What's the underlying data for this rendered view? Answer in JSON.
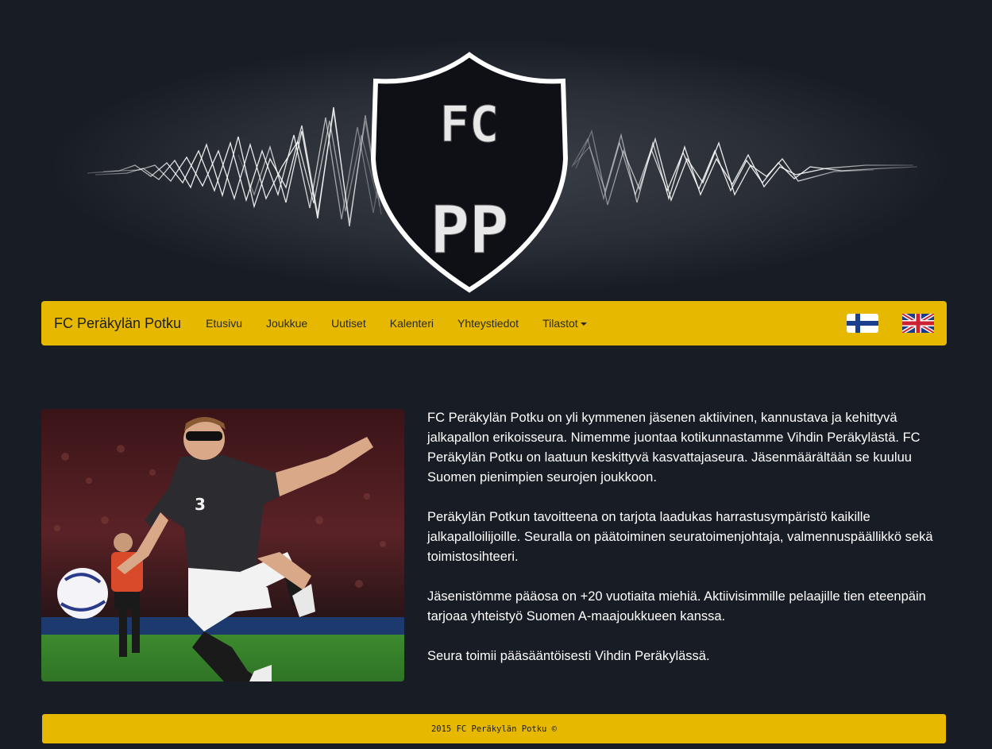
{
  "logo": {
    "top_letters": "FC",
    "bottom_letters": "PP"
  },
  "navbar": {
    "brand": "FC Peräkylän Potku",
    "items": [
      {
        "label": "Etusivu"
      },
      {
        "label": "Joukkue"
      },
      {
        "label": "Uutiset"
      },
      {
        "label": "Kalenteri"
      },
      {
        "label": "Yhteystiedot"
      },
      {
        "label": "Tilastot",
        "has_dropdown": true
      }
    ],
    "languages": [
      {
        "code": "fi",
        "icon": "finnish-flag-icon"
      },
      {
        "code": "en",
        "icon": "uk-flag-icon"
      }
    ]
  },
  "hero_image": {
    "jersey_number": "3"
  },
  "content": {
    "paragraphs": [
      "FC Peräkylän Potku on yli kymmenen jäsenen aktiivinen, kannustava ja kehittyvä jalkapallon erikoisseura. Nimemme juontaa kotikunnastamme Vihdin Peräkylästä. FC Peräkylän Potku on laatuun keskittyvä kasvattajaseura. Jäsenmäärältään se kuuluu Suomen pienimpien seurojen joukkoon.",
      "Peräkylän Potkun tavoitteena on tarjota laadukas harrastusympäristö kaikille jalkapalloilijoille. Seuralla on päätoiminen seuratoimenjohtaja, valmennuspäällikkö sekä toimistosihteeri.",
      "Jäsenistömme pääosa on +20 vuotiaita miehiä. Aktiivisimmille pelaajille tien eteenpäin tarjoaa yhteistyö Suomen A-maajoukkueen kanssa.",
      "Seura toimii pääsääntöisesti Vihdin Peräkylässä."
    ]
  },
  "footer": {
    "text": "2015 FC Peräkylän Potku ©"
  },
  "colors": {
    "background": "#181c24",
    "accent": "#e6b800"
  }
}
